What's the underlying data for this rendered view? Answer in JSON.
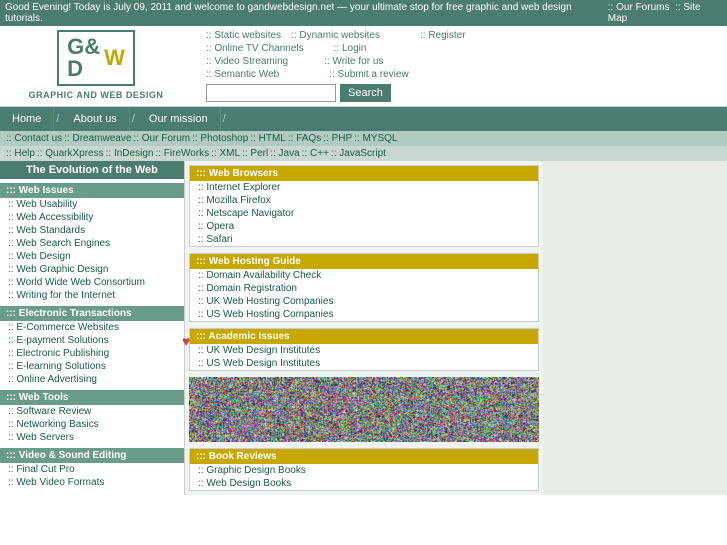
{
  "topbar": {
    "message": "Good Evening! Today is July 09, 2011 and welcome to gandwebdesign.net — your ultimate stop for free graphic and web design tutorials.",
    "forums": "Our Forums",
    "sitemap": "Site Map"
  },
  "logo": {
    "line1": "G&",
    "line2": "D",
    "line3": "W",
    "tagline": "GRAPHIC AND WEB DESIGN"
  },
  "nav_links": {
    "col1": [
      "Static websites",
      "Dynamic websites",
      "Online TV Channels",
      "Video Streaming",
      "Semantic Web"
    ],
    "col2": [
      "Register",
      "Login",
      "Write for us",
      "Submit a review"
    ]
  },
  "search": {
    "placeholder": "",
    "button_label": "Search"
  },
  "nav_tabs": [
    "Home",
    "About us",
    "Our mission"
  ],
  "subnav1": [
    "Contact us",
    "Dreamweave",
    "Our Forum",
    "Photoshop",
    "HTML",
    "FAQs",
    "PHP",
    "MYSQL"
  ],
  "subnav2": [
    "Help",
    "QuarkXpress",
    "InDesign",
    "FireWorks",
    "XML",
    "Perl",
    "Java",
    "C++",
    "JavaScript"
  ],
  "sidebar": {
    "title": "The Evolution of the Web",
    "sections": [
      {
        "header": "Web Issues",
        "items": [
          "Web Usability",
          "Web Accessibility",
          "Web Standards",
          "Web Search Engines",
          "Web Design",
          "Web Graphic Design",
          "World Wide Web Consortium",
          "Writing for the Internet"
        ]
      },
      {
        "header": "Electronic Transactions",
        "items": [
          "E-Commerce Websites",
          "E-payment Solutions",
          "Electronic Publishing",
          "E-learning Solutions",
          "Online Advertising"
        ]
      },
      {
        "header": "Web Tools",
        "items": [
          "Software Review",
          "Networking Basics",
          "Web Servers"
        ]
      },
      {
        "header": "Video & Sound Editing",
        "items": [
          "Final Cut Pro",
          "Web Video Formats"
        ]
      }
    ]
  },
  "content_boxes": [
    {
      "header": "Web Browsers",
      "items": [
        "Internet Explorer",
        "Mozilla Firefox",
        "Netscape Navigator",
        "Opera",
        "Safari"
      ]
    },
    {
      "header": "Web Hosting Guide",
      "items": [
        "Domain Availability Check",
        "Domain Registration",
        "UK Web Hosting Companies",
        "US Web Hosting Companies"
      ]
    },
    {
      "header": "Academic Issues",
      "items": [
        "UK Web Design Institutes",
        "US Web Design Institutes"
      ]
    },
    {
      "header": "Book Reviews",
      "items": [
        "Graphic Design Books",
        "Web Design Books"
      ]
    }
  ],
  "colors": {
    "primary": "#4a7c6f",
    "secondary": "#c6a800",
    "link": "#1a5a4a"
  }
}
